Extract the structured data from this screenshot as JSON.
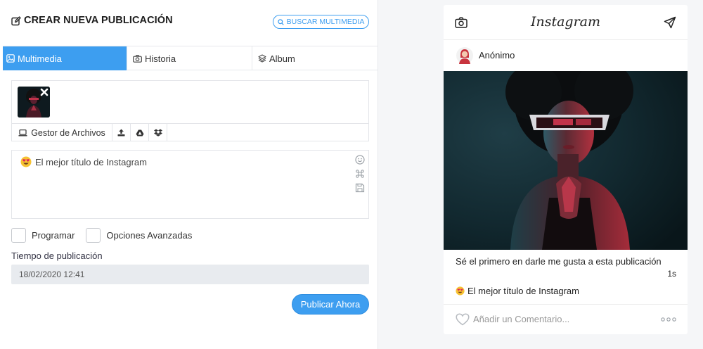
{
  "header": {
    "title": "CREAR NUEVA PUBLICACIÓN",
    "search_label": "BUSCAR MULTIMEDIA",
    "icon": "edit-icon"
  },
  "tabs": [
    {
      "label": "Multimedia",
      "icon": "image-icon",
      "active": true
    },
    {
      "label": "Historia",
      "icon": "camera-icon",
      "active": false
    },
    {
      "label": "Album",
      "icon": "layers-icon",
      "active": false
    }
  ],
  "media": {
    "files_label": "Gestor de Archivos",
    "toolbar_icons": [
      "upload-icon",
      "google-drive-icon",
      "dropbox-icon"
    ]
  },
  "caption": {
    "emoji": "😍",
    "text": "El mejor título de Instagram",
    "tools": [
      "emoji-smile-icon",
      "command-icon",
      "save-icon"
    ]
  },
  "options": {
    "schedule_label": "Programar",
    "advanced_label": "Opciones Avanzadas"
  },
  "time": {
    "label": "Tiempo de publicación",
    "value": "18/02/2020 12:41"
  },
  "publish_label": "Publicar Ahora",
  "preview": {
    "logo": "Instagram",
    "username": "Anónimo",
    "likes_text": "Sé el primero en darle me gusta a esta publicación",
    "time_ago": "1s",
    "caption_emoji": "😍",
    "caption_text": "El mejor título de Instagram",
    "comment_placeholder": "Añadir un Comentario..."
  },
  "colors": {
    "accent": "#3d9ef0",
    "panel_bg": "#ffffff",
    "page_bg": "#f5f6f8"
  }
}
